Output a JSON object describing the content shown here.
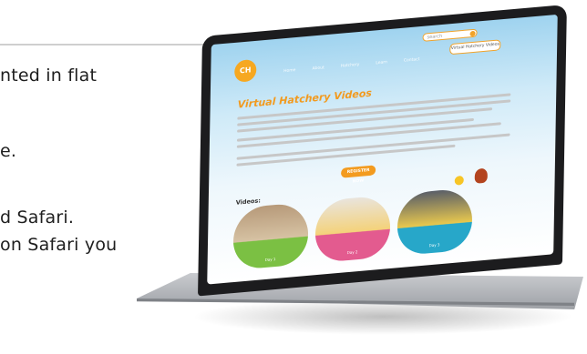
{
  "slide": {
    "line1": "nted in flat",
    "line2": "e.",
    "line3": "d Safari.",
    "line4": "on Safari you"
  },
  "laptop_site": {
    "logo": "CH",
    "search_placeholder": "search",
    "header_button": "Virtual Hatchery Videos",
    "nav": [
      "Home",
      "About",
      "Hatchery",
      "Learn",
      "Contact"
    ],
    "page_title": "Virtual Hatchery Videos",
    "cta_label": "REGISTER NOW",
    "videos_label": "Videos:",
    "video_captions": [
      "Day 1",
      "Day 2",
      "Day 3"
    ]
  },
  "colors": {
    "accent": "#f29a1e",
    "sky": "#9fd3ef",
    "laptop_bezel": "#1c1c1e"
  }
}
